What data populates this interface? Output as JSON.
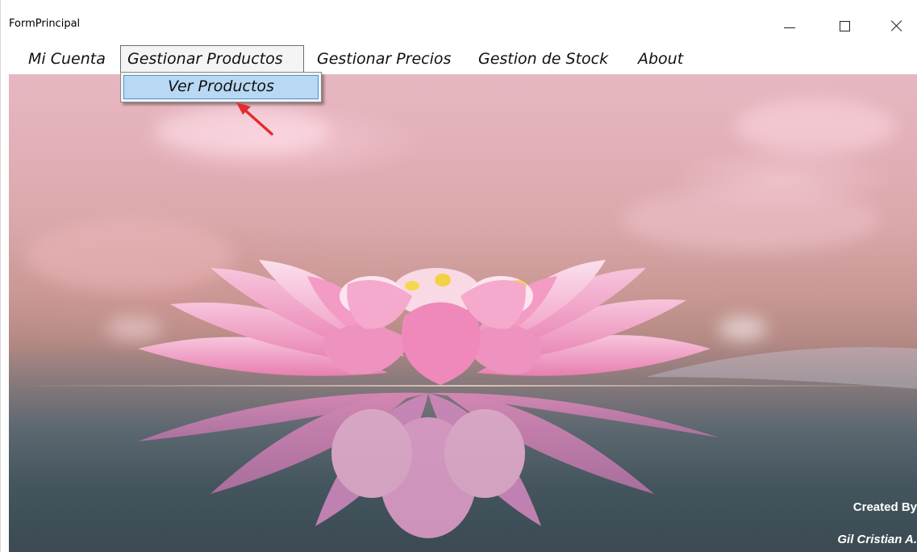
{
  "window": {
    "title": "FormPrincipal",
    "controls": {
      "minimize_icon": "minimize-icon",
      "maximize_icon": "maximize-icon",
      "close_icon": "close-icon"
    }
  },
  "menu": {
    "items": [
      {
        "label": "Mi Cuenta"
      },
      {
        "label": "Gestionar Productos",
        "open": true
      },
      {
        "label": "Gestionar Precios"
      },
      {
        "label": "Gestion de Stock"
      },
      {
        "label": "About"
      }
    ],
    "dropdown": {
      "items": [
        {
          "label": "Ver Productos",
          "highlighted": true
        }
      ]
    }
  },
  "annotation": {
    "arrow_color": "#e32b2b"
  },
  "credits": {
    "line1": "Created By",
    "line2": "Gil Cristian A."
  },
  "colors": {
    "dropdown_highlight": "#b8d8f4",
    "dropdown_highlight_border": "#4a94d8"
  }
}
